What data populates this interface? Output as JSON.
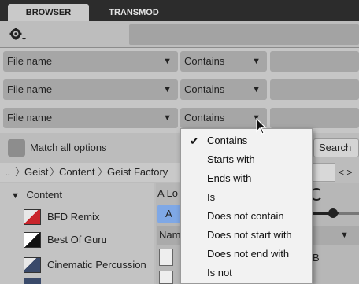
{
  "tabs": {
    "browser": "BROWSER",
    "transmod": "TRANSMOD"
  },
  "toolbar": {
    "gear_icon": "gear-icon",
    "search_icon": "search-icon"
  },
  "filters": [
    {
      "field": "File name",
      "operator": "Contains"
    },
    {
      "field": "File name",
      "operator": "Contains"
    },
    {
      "field": "File name",
      "operator": "Contains"
    }
  ],
  "match_all_label": "Match all options",
  "search_button": "Search",
  "breadcrumb": {
    "back": "..",
    "items": [
      "Geist",
      "Content",
      "Geist Factory"
    ],
    "nav": "< >"
  },
  "tree": {
    "root": "Content",
    "items": [
      "BFD Remix",
      "Best Of Guru",
      "Cinematic Percussion"
    ]
  },
  "right_panel": {
    "partial_a": "A Lo",
    "partial_b": "A",
    "name_header": "Nam",
    "col_b": "B"
  },
  "dropdown_menu": {
    "selected": "Contains",
    "options": [
      "Contains",
      "Starts with",
      "Ends with",
      "Is",
      "Does not contain",
      "Does not start with",
      "Does not end with",
      "Is not"
    ]
  },
  "colors": {
    "accent": "#2f6fd6",
    "menu_bg": "#f2f2f2",
    "tabbar": "#2c2c2c"
  }
}
